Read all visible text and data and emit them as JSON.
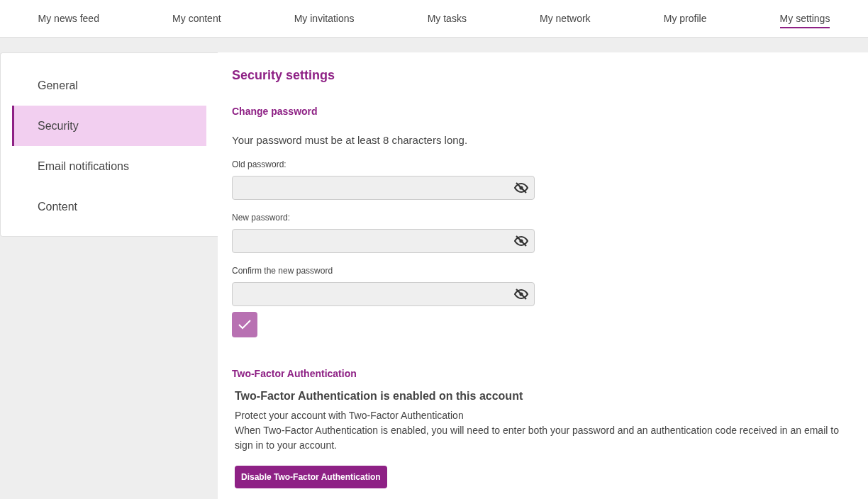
{
  "nav": [
    {
      "label": "My news feed",
      "selected": false
    },
    {
      "label": "My content",
      "selected": false
    },
    {
      "label": "My invitations",
      "selected": false
    },
    {
      "label": "My tasks",
      "selected": false
    },
    {
      "label": "My network",
      "selected": false
    },
    {
      "label": "My profile",
      "selected": false
    },
    {
      "label": "My settings",
      "selected": true
    }
  ],
  "sidebar": {
    "items": [
      {
        "label": "General",
        "selected": false
      },
      {
        "label": "Security",
        "selected": true
      },
      {
        "label": "Email notifications",
        "selected": false
      },
      {
        "label": "Content",
        "selected": false
      }
    ]
  },
  "main": {
    "title": "Security settings",
    "change_password": {
      "heading": "Change password",
      "hint": "Your password must be at least 8 characters long.",
      "fields": [
        {
          "label": "Old password:"
        },
        {
          "label": "New password:"
        },
        {
          "label": "Confirm the new password"
        }
      ]
    },
    "two_factor": {
      "heading": "Two-Factor Authentication",
      "status": "Two-Factor Authentication is enabled on this account",
      "intro": "Protect your account with Two-Factor Authentication",
      "description": "When Two-Factor Authentication is enabled, you will need to enter both your password and an authentication code received in an email to sign in to your account.",
      "button": "Disable Two-Factor Authentication"
    }
  }
}
